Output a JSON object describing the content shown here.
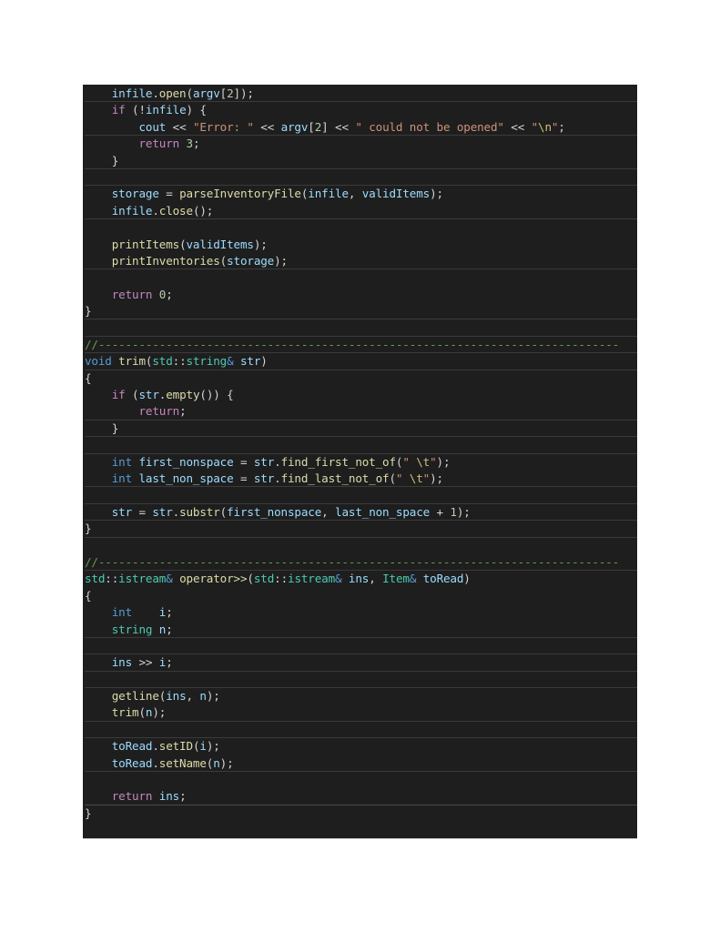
{
  "editor": {
    "theme": "dark",
    "colors": {
      "background": "#1e1e1e",
      "keyword_control": "#c586c0",
      "keyword_type": "#569cd6",
      "class_type": "#4ec9b0",
      "function": "#dcdcaa",
      "variable": "#9cdcfe",
      "string": "#ce9178",
      "escape": "#d7ba7d",
      "number": "#b5cea8",
      "comment": "#6a9955",
      "default": "#d4d4d4"
    },
    "lines": [
      {
        "tokens": [
          [
            "    ",
            "pun"
          ],
          [
            "infile",
            "var"
          ],
          [
            ".",
            "pun"
          ],
          [
            "open",
            "fn"
          ],
          [
            "(",
            "pun"
          ],
          [
            "argv",
            "var"
          ],
          [
            "[",
            "pun"
          ],
          [
            "2",
            "num"
          ],
          [
            "]);",
            "pun"
          ]
        ],
        "sep": "sep-bottom"
      },
      {
        "tokens": [
          [
            "    ",
            "pun"
          ],
          [
            "if",
            "kw"
          ],
          [
            " (!",
            "pun"
          ],
          [
            "infile",
            "var"
          ],
          [
            ") {",
            "pun"
          ]
        ]
      },
      {
        "tokens": [
          [
            "        ",
            "pun"
          ],
          [
            "cout",
            "var"
          ],
          [
            " << ",
            "op"
          ],
          [
            "\"Error: \"",
            "str"
          ],
          [
            " << ",
            "op"
          ],
          [
            "argv",
            "var"
          ],
          [
            "[",
            "pun"
          ],
          [
            "2",
            "num"
          ],
          [
            "] << ",
            "pun"
          ],
          [
            "\" could not be opened\"",
            "str"
          ],
          [
            " << ",
            "op"
          ],
          [
            "\"",
            "str"
          ],
          [
            "\\n",
            "esc"
          ],
          [
            "\"",
            "str"
          ],
          [
            ";",
            "pun"
          ]
        ],
        "sep": "sep-bottom"
      },
      {
        "tokens": [
          [
            "        ",
            "pun"
          ],
          [
            "return",
            "kw"
          ],
          [
            " ",
            "pun"
          ],
          [
            "3",
            "num"
          ],
          [
            ";",
            "pun"
          ]
        ]
      },
      {
        "tokens": [
          [
            "    }",
            "pun"
          ]
        ],
        "sep": "sep-bottom"
      },
      {
        "tokens": [
          [
            "",
            "pun"
          ]
        ],
        "sep": "sep-bottom"
      },
      {
        "tokens": [
          [
            "    ",
            "pun"
          ],
          [
            "storage",
            "var"
          ],
          [
            " = ",
            "op"
          ],
          [
            "parseInventoryFile",
            "fn"
          ],
          [
            "(",
            "pun"
          ],
          [
            "infile",
            "var"
          ],
          [
            ", ",
            "pun"
          ],
          [
            "validItems",
            "var"
          ],
          [
            ");",
            "pun"
          ]
        ]
      },
      {
        "tokens": [
          [
            "    ",
            "pun"
          ],
          [
            "infile",
            "var"
          ],
          [
            ".",
            "pun"
          ],
          [
            "close",
            "fn"
          ],
          [
            "();",
            "pun"
          ]
        ],
        "sep": "sep-bottom"
      },
      {
        "tokens": [
          [
            "",
            "pun"
          ]
        ]
      },
      {
        "tokens": [
          [
            "    ",
            "pun"
          ],
          [
            "printItems",
            "fn"
          ],
          [
            "(",
            "pun"
          ],
          [
            "validItems",
            "var"
          ],
          [
            ");",
            "pun"
          ]
        ]
      },
      {
        "tokens": [
          [
            "    ",
            "pun"
          ],
          [
            "printInventories",
            "fn"
          ],
          [
            "(",
            "pun"
          ],
          [
            "storage",
            "var"
          ],
          [
            ");",
            "pun"
          ]
        ],
        "sep": "sep-bottom"
      },
      {
        "tokens": [
          [
            "",
            "pun"
          ]
        ]
      },
      {
        "tokens": [
          [
            "    ",
            "pun"
          ],
          [
            "return",
            "kw"
          ],
          [
            " ",
            "pun"
          ],
          [
            "0",
            "num"
          ],
          [
            ";",
            "pun"
          ]
        ]
      },
      {
        "tokens": [
          [
            "}",
            "pun"
          ]
        ],
        "sep": "sep-bottom"
      },
      {
        "tokens": [
          [
            "",
            "pun"
          ]
        ],
        "sep": "sep-bottom"
      },
      {
        "tokens": [
          [
            "//-----------------------------------------------------------------------------",
            "com"
          ]
        ],
        "sep": "sep-bottom"
      },
      {
        "tokens": [
          [
            "void",
            "type"
          ],
          [
            " ",
            "pun"
          ],
          [
            "trim",
            "fn"
          ],
          [
            "(",
            "pun"
          ],
          [
            "std",
            "cls"
          ],
          [
            "::",
            "pun"
          ],
          [
            "string",
            "cls"
          ],
          [
            "&",
            "type"
          ],
          [
            " ",
            "pun"
          ],
          [
            "str",
            "var"
          ],
          [
            ")",
            "pun"
          ]
        ],
        "sep": "sep-bottom"
      },
      {
        "tokens": [
          [
            "{",
            "pun"
          ]
        ]
      },
      {
        "tokens": [
          [
            "    ",
            "pun"
          ],
          [
            "if",
            "kw"
          ],
          [
            " (",
            "pun"
          ],
          [
            "str",
            "var"
          ],
          [
            ".",
            "pun"
          ],
          [
            "empty",
            "fn"
          ],
          [
            "()) {",
            "pun"
          ]
        ]
      },
      {
        "tokens": [
          [
            "        ",
            "pun"
          ],
          [
            "return",
            "kw"
          ],
          [
            ";",
            "pun"
          ]
        ],
        "sep": "sep-bottom"
      },
      {
        "tokens": [
          [
            "    }",
            "pun"
          ]
        ],
        "sep": "sep-bottom"
      },
      {
        "tokens": [
          [
            "",
            "pun"
          ]
        ],
        "sep": "sep-bottom"
      },
      {
        "tokens": [
          [
            "    ",
            "pun"
          ],
          [
            "int",
            "type"
          ],
          [
            " ",
            "pun"
          ],
          [
            "first_nonspace",
            "var"
          ],
          [
            " = ",
            "op"
          ],
          [
            "str",
            "var"
          ],
          [
            ".",
            "pun"
          ],
          [
            "find_first_not_of",
            "fn"
          ],
          [
            "(",
            "pun"
          ],
          [
            "\" ",
            "str"
          ],
          [
            "\\t",
            "esc"
          ],
          [
            "\"",
            "str"
          ],
          [
            ");",
            "pun"
          ]
        ]
      },
      {
        "tokens": [
          [
            "    ",
            "pun"
          ],
          [
            "int",
            "type"
          ],
          [
            " ",
            "pun"
          ],
          [
            "last_non_space",
            "var"
          ],
          [
            " = ",
            "op"
          ],
          [
            "str",
            "var"
          ],
          [
            ".",
            "pun"
          ],
          [
            "find_last_not_of",
            "fn"
          ],
          [
            "(",
            "pun"
          ],
          [
            "\" ",
            "str"
          ],
          [
            "\\t",
            "esc"
          ],
          [
            "\"",
            "str"
          ],
          [
            ");",
            "pun"
          ]
        ],
        "sep": "sep-bottom"
      },
      {
        "tokens": [
          [
            "",
            "pun"
          ]
        ],
        "sep": "sep-bottom"
      },
      {
        "tokens": [
          [
            "    ",
            "pun"
          ],
          [
            "str",
            "var"
          ],
          [
            " = ",
            "op"
          ],
          [
            "str",
            "var"
          ],
          [
            ".",
            "pun"
          ],
          [
            "substr",
            "fn"
          ],
          [
            "(",
            "pun"
          ],
          [
            "first_nonspace",
            "var"
          ],
          [
            ", ",
            "pun"
          ],
          [
            "last_non_space",
            "var"
          ],
          [
            " + ",
            "op"
          ],
          [
            "1",
            "num"
          ],
          [
            ");",
            "pun"
          ]
        ],
        "sep": "sep-bottom"
      },
      {
        "tokens": [
          [
            "}",
            "pun"
          ]
        ],
        "sep": "sep-bottom"
      },
      {
        "tokens": [
          [
            "",
            "pun"
          ]
        ]
      },
      {
        "tokens": [
          [
            "//-----------------------------------------------------------------------------",
            "com"
          ]
        ],
        "sep": "sep-bottom"
      },
      {
        "tokens": [
          [
            "std",
            "cls"
          ],
          [
            "::",
            "pun"
          ],
          [
            "istream",
            "cls"
          ],
          [
            "&",
            "type"
          ],
          [
            " ",
            "pun"
          ],
          [
            "operator>>",
            "fn"
          ],
          [
            "(",
            "pun"
          ],
          [
            "std",
            "cls"
          ],
          [
            "::",
            "pun"
          ],
          [
            "istream",
            "cls"
          ],
          [
            "&",
            "type"
          ],
          [
            " ",
            "pun"
          ],
          [
            "ins",
            "var"
          ],
          [
            ", ",
            "pun"
          ],
          [
            "Item",
            "cls"
          ],
          [
            "&",
            "type"
          ],
          [
            " ",
            "pun"
          ],
          [
            "toRead",
            "var"
          ],
          [
            ")",
            "pun"
          ]
        ]
      },
      {
        "tokens": [
          [
            "{",
            "pun"
          ]
        ]
      },
      {
        "tokens": [
          [
            "    ",
            "pun"
          ],
          [
            "int",
            "type"
          ],
          [
            "    ",
            "pun"
          ],
          [
            "i",
            "var"
          ],
          [
            ";",
            "pun"
          ]
        ]
      },
      {
        "tokens": [
          [
            "    ",
            "pun"
          ],
          [
            "string",
            "cls"
          ],
          [
            " ",
            "pun"
          ],
          [
            "n",
            "var"
          ],
          [
            ";",
            "pun"
          ]
        ],
        "sep": "sep-bottom"
      },
      {
        "tokens": [
          [
            "",
            "pun"
          ]
        ],
        "sep": "sep-bottom"
      },
      {
        "tokens": [
          [
            "    ",
            "pun"
          ],
          [
            "ins",
            "var"
          ],
          [
            " >> ",
            "op"
          ],
          [
            "i",
            "var"
          ],
          [
            ";",
            "pun"
          ]
        ],
        "sep": "sep-bottom"
      },
      {
        "tokens": [
          [
            "",
            "pun"
          ]
        ],
        "sep": "sep-bottom"
      },
      {
        "tokens": [
          [
            "    ",
            "pun"
          ],
          [
            "getline",
            "fn"
          ],
          [
            "(",
            "pun"
          ],
          [
            "ins",
            "var"
          ],
          [
            ", ",
            "pun"
          ],
          [
            "n",
            "var"
          ],
          [
            ");",
            "pun"
          ]
        ]
      },
      {
        "tokens": [
          [
            "    ",
            "pun"
          ],
          [
            "trim",
            "fn"
          ],
          [
            "(",
            "pun"
          ],
          [
            "n",
            "var"
          ],
          [
            ");",
            "pun"
          ]
        ],
        "sep": "sep-bottom"
      },
      {
        "tokens": [
          [
            "",
            "pun"
          ]
        ],
        "sep": "sep-bottom"
      },
      {
        "tokens": [
          [
            "    ",
            "pun"
          ],
          [
            "toRead",
            "var"
          ],
          [
            ".",
            "pun"
          ],
          [
            "setID",
            "fn"
          ],
          [
            "(",
            "pun"
          ],
          [
            "i",
            "var"
          ],
          [
            ");",
            "pun"
          ]
        ]
      },
      {
        "tokens": [
          [
            "    ",
            "pun"
          ],
          [
            "toRead",
            "var"
          ],
          [
            ".",
            "pun"
          ],
          [
            "setName",
            "fn"
          ],
          [
            "(",
            "pun"
          ],
          [
            "n",
            "var"
          ],
          [
            ");",
            "pun"
          ]
        ],
        "sep": "sep-bottom"
      },
      {
        "tokens": [
          [
            "",
            "pun"
          ]
        ]
      },
      {
        "tokens": [
          [
            "    ",
            "pun"
          ],
          [
            "return",
            "kw"
          ],
          [
            " ",
            "pun"
          ],
          [
            "ins",
            "var"
          ],
          [
            ";",
            "pun"
          ]
        ],
        "sep": "sep-bottom-strong"
      },
      {
        "tokens": [
          [
            "}",
            "pun"
          ]
        ]
      }
    ]
  }
}
